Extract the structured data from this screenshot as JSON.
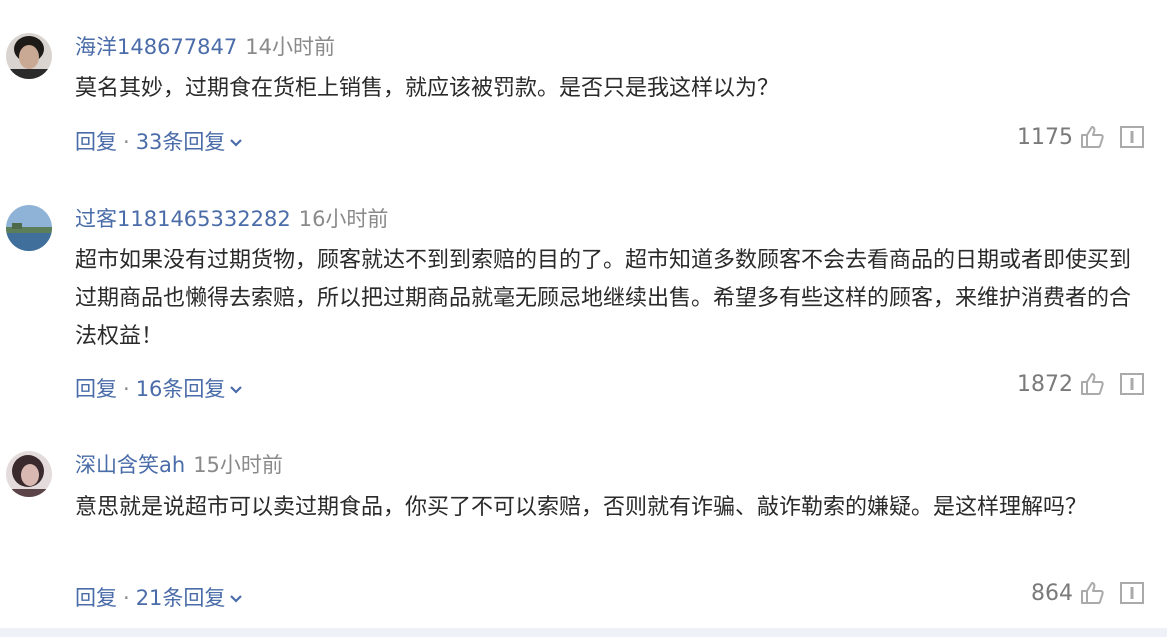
{
  "comments": [
    {
      "username": "海洋148677847",
      "time": "14小时前",
      "content": "莫名其妙，过期食在货柜上销售，就应该被罚款。是否只是我这样以为？",
      "reply_label": "回复",
      "replies_label": "33条回复",
      "likes": "1175",
      "avatar": "dark-hair-portrait"
    },
    {
      "username": "过客1181465332282",
      "time": "16小时前",
      "content": "超市如果没有过期货物，顾客就达不到到索赔的目的了。超市知道多数顾客不会去看商品的日期或者即使买到过期商品也懒得去索赔，所以把过期商品就毫无顾忌地继续出售。希望多有些这样的顾客，来维护消费者的合法权益！",
      "reply_label": "回复",
      "replies_label": "16条回复",
      "likes": "1872",
      "avatar": "lake-landscape"
    },
    {
      "username": "深山含笑ah",
      "time": "15小时前",
      "content": "意思就是说超市可以卖过期食品，你买了不可以索赔，否则就有诈骗、敲诈勒索的嫌疑。是这样理解吗？",
      "reply_label": "回复",
      "replies_label": "21条回复",
      "likes": "864",
      "avatar": "woman-portrait"
    }
  ],
  "colors": {
    "username": "#4a6ca8",
    "time": "#8a8a8a",
    "text": "#2a2a2a",
    "count": "#7a7a7a"
  }
}
